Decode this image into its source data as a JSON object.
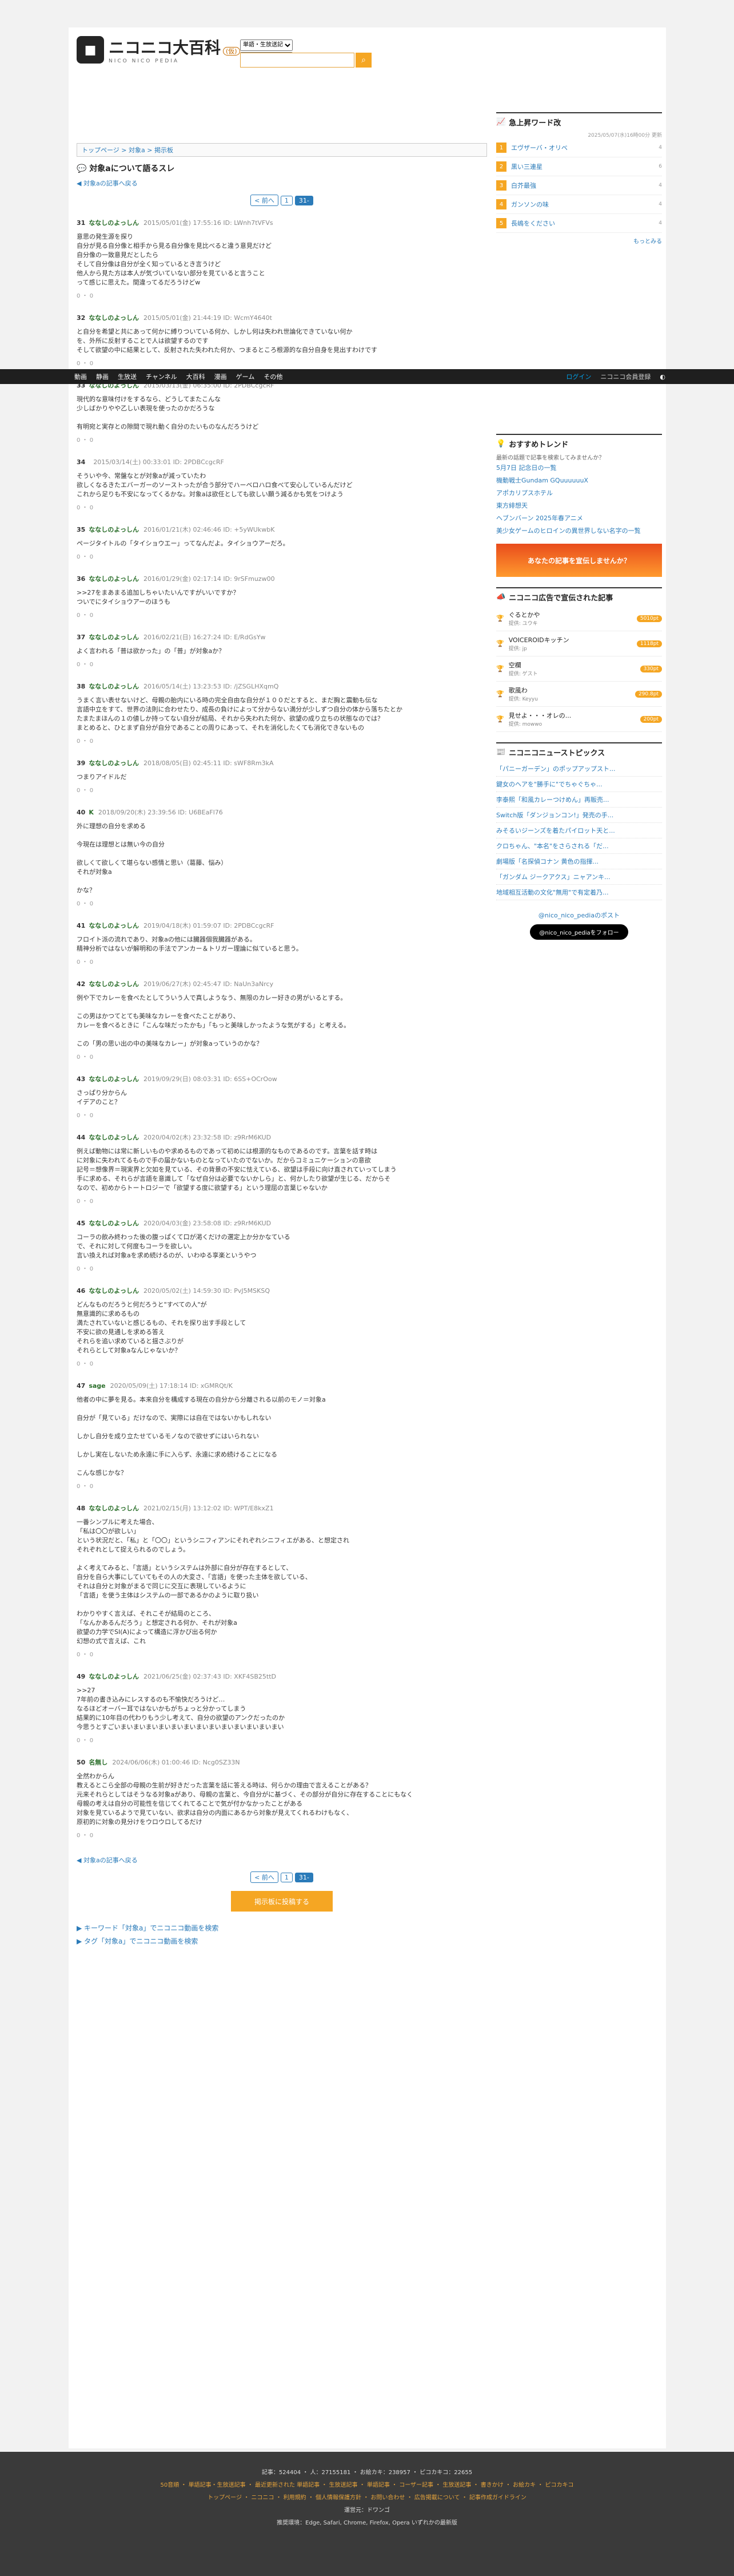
{
  "site": {
    "logo": "ニコニコ大百科",
    "beta": "(仮)",
    "logo_sub": "NICO NICO PEDIA"
  },
  "search": {
    "scope": "単語・生放送記事",
    "mode": "タイトル"
  },
  "topbar": {
    "items": [
      "動画",
      "静画",
      "生放送",
      "チャンネル",
      "大百科",
      "漫画",
      "ゲーム",
      "その他"
    ],
    "login": "ログイン",
    "register": "ニコニコ会員登録"
  },
  "breadcrumb": "トップページ > 対象a > 掲示板",
  "page_title": "対象aについて語るスレ",
  "back_link": "対象aの記事へ戻る",
  "pager": {
    "prev": "< 前へ",
    "p1": "1",
    "p2": "31-"
  },
  "posts": [
    {
      "num": "31",
      "name": "ななしのよっしん",
      "meta": "2015/05/01(金) 17:55:16 ID: LWnh7tVFVs",
      "body": "意思の発生源を探り\n自分が見る自分像と相手から見る自分像を見比べると違う意見だけど\n自分像の一致意見だとしたら\nそして自分像は自分が全く知っているとき言うけど\n他人から見た方は本人が気づいていない部分を見ていると言うこと\nって感じに思えた。間違ってるだろうけどw",
      "r": "0 ・ 0"
    },
    {
      "num": "32",
      "name": "ななしのよっしん",
      "meta": "2015/05/01(金) 21:44:19 ID: WcmY4640t",
      "body": "と自分を希望と共にあって何かに縛りついている何か、しかし何は失われ世論化できていない何か\nを、外所に反射することで人は欲望するのです\nそして欲望の中に結果として、反射された失われた何か、つまるところ根源的な自分自身を見出すわけです",
      "r": "0 ・ 0"
    },
    {
      "num": "33",
      "name": "ななしのよっしん",
      "meta": "2015/03/13(金) 06:35:00 ID: 2PDBCcgcRF",
      "body": "現代的な意味付けをするなら、どうしてまたこんな\n少しばかりやや乙しい表現を使ったのかだろうな\n\n有明宛と実存との隙間で現れ動く自分のたいものなんだろうけど",
      "r": "0 ・ 0"
    },
    {
      "num": "34",
      "name": "",
      "meta": "2015/03/14(土) 00:33:01 ID: 2PDBCcgcRF",
      "body": "そういや今、常盤なとが対象aが減っていたわ\n欲しくなるきたエバーガーのソーストったが合う部分でハーベロハロ食べて安心しているんだけど\nこれから足りも不安になってくるかな。対象aは欲任としても欲しい願う減るかも気をつけよう",
      "r": "0 ・ 0"
    },
    {
      "num": "35",
      "name": "ななしのよっしん",
      "meta": "2016/01/21(木) 02:46:46 ID: +5yWUkwbK",
      "body": "ページタイトルの「タイショウエー」ってなんだよ。タイショウアーだろ。",
      "r": "0 ・ 0"
    },
    {
      "num": "36",
      "name": "ななしのよっしん",
      "meta": "2016/01/29(金) 02:17:14 ID: 9rSFmuzw00",
      "body": ">>27をまあまる追加しちゃいたいんですがいいですか？\nついでにタイショウアーのほうも",
      "r": "0 ・ 0"
    },
    {
      "num": "37",
      "name": "ななしのよっしん",
      "meta": "2016/02/21(日) 16:27:24 ID: E/RdGsYw",
      "body": "よく言われる「普は欲かった」の「普」が対象aか？",
      "r": "0 ・ 0"
    },
    {
      "num": "38",
      "name": "ななしのよっしん",
      "meta": "2016/05/14(土) 13:23:53 ID: /jZSGLHXqmQ",
      "body": "うまく言い表せないけど、母親の胎内にいる時の完全自由な自分が１００だとすると、まだ胸と震動も伝な\n言語中立をすて、世界の法則に合わせたり、成長の負けによって分からない満分が少しずつ自分の体から落ちたとか\nたまたまほんの１の値しか持ってない自分が結局、それから失われた何か、欲望の成り立ちの状態なのでは？\nまとめると、ひとまず自分が自分であることの周りにあって、それを消化したくても消化できないもの",
      "r": "0 ・ 0"
    },
    {
      "num": "39",
      "name": "ななしのよっしん",
      "meta": "2018/08/05(日) 02:45:11 ID: sWF8Rm3kA",
      "body": "つまりアイドルだ",
      "r": "0 ・ 0"
    },
    {
      "num": "40",
      "name": "K",
      "meta": "2018/09/20(木) 23:39:56 ID: U6BEaFl76",
      "body": "外に理想の自分を求める\n\n今現在は理想とは無い今の自分\n\n欲しくて欲しくて堪らない感情と思い（葛藤、悩み）\nそれが対象a\n\nかな？",
      "r": "0 ・ 0"
    },
    {
      "num": "41",
      "name": "ななしのよっしん",
      "meta": "2019/04/18(木) 01:59:07 ID: 2PDBCcgcRF",
      "body": "フロイト派の流れであり、対象aの他には臓器個我臓器がある。\n精神分析ではないが解明和の手法でアンカー＆トリガー理論に似ていると思う。",
      "r": "0 ・ 0"
    },
    {
      "num": "42",
      "name": "ななしのよっしん",
      "meta": "2019/06/27(木) 02:45:47 ID: NaUn3aNrcy",
      "body": "例や下でカレーを食べたとしてういう人で真しようなう、無限のカレー好きの男がいるとする。\n\nこの男はかつてとても美味なカレーを食べたことがあり、\nカレーを食べるときに「こんな味だったかも」「もっと美味しかったような気がする」と考える。\n\nこの「男の思い出の中の美味なカレー」が対象aっていうのかな？",
      "r": "0 ・ 0"
    },
    {
      "num": "43",
      "name": "ななしのよっしん",
      "meta": "2019/09/29(日) 08:03:31 ID: 6SS+OCrOow",
      "body": "さっぱり分からん\nイデアのこと？",
      "r": "0 ・ 0"
    },
    {
      "num": "44",
      "name": "ななしのよっしん",
      "meta": "2020/04/02(木) 23:32:58 ID: z9RrM6KUD",
      "body": "例えば動物には常に新しいものや求めるものであって初めには根源的なものであるのです。言葉を話す時は\nに対象に失われてるもので手の届かないものとなっていたのでないか。だからコミュニケーションの意欲\n記号＝想像界＝現実界と欠如を見ている、その背景の不安に怯えている、欲望は手段に向け直されていってしまう\n手に求める、それらが言語を意識して「なぜ自分は必要でないかしら」と、何かしたり欲望が生じる、だからそ\nなので、初めからトートロジーで「欲望する度に欲望する」という理屈の言葉じゃないか",
      "r": "0 ・ 0"
    },
    {
      "num": "45",
      "name": "ななしのよっしん",
      "meta": "2020/04/03(金) 23:58:08 ID: z9RrM6KUD",
      "body": "コーラの飲み終わった後の腹っぱくて口が渇くだけの選定上か分かなている\nで、それに対して何度もコーラを欲しい。\n言い換えれば対象aを求め続けるのが、いわゆる享楽というやつ",
      "r": "0 ・ 0"
    },
    {
      "num": "46",
      "name": "ななしのよっしん",
      "meta": "2020/05/02(土) 14:59:30 ID: PvJ5MSKSQ",
      "body": "どんなものだろうと何だろうと\"すべての人\"が\n無意識的に求めるもの\n満たされていないと感じるもの、それを探り出す手段として\n不安に欲の見通しを求める答え\nそれらを追い求めていると揺さぶりが\nそれらとして対象aなんじゃないか？",
      "r": "0 ・ 0"
    },
    {
      "num": "47",
      "name": "sage",
      "meta": "2020/05/09(土) 17:18:14 ID: xGMRQt/K",
      "body": "他者の中に夢を見る。本来自分を構成する現在の自分から分離される以前のモノ＝対象a\n\n自分が「見ている」だけなので、実際には自在ではないかもしれない\n\nしかし自分を成り立たせているモノなので欲せずにはいられない\n\nしかし実在しないため永遠に手に入らず、永遠に求め続けることになる\n\nこんな感じかな？",
      "r": "0 ・ 0"
    },
    {
      "num": "48",
      "name": "ななしのよっしん",
      "meta": "2021/02/15(月) 13:12:02 ID: WPT/E8kxZ1",
      "body": "一番シンプルに考えた場合、\n「私は〇〇が欲しい」\nという状況だと、「私」と「〇〇」というシニフィアンにそれぞれシニフィエがある、と想定され\nそれぞれとして捉えられるのでしょう。\n\nよく考えてみると、「言語」というシステムは外部に自分が存在するとして、\n自分を自ら大事にしていてもその人の大変さ、「言語」を使った主体を欲している、\nそれは自分と対象がまるで同じに交互に表現しているように\n「言語」を使う主体はシステムの一部であるかのように取り扱い\n\nわかりやすく言えば、それこそが結局のところ、\n「なんかあるんだろう」と想定される何か、それが対象a\n欲望の力学でSI(A)によって構造に浮かび出る何か\n幻想の式で言えば、これ",
      "r": "0 ・ 0"
    },
    {
      "num": "49",
      "name": "ななしのよっしん",
      "meta": "2021/06/25(金) 02:37:43 ID: XKF4SB25ttD",
      "body": ">>27\n7年前の書き込みにレスするのも不愉快だろうけど…\nなるほどオーバー耳ではないかもがちょっと分かってしまう\n結果的に10年目の代わりもう少し考えて、自分の欲望のアンクだったのか\n今思うとすごいまいまいまいまいまいまいまいまいまいまいまいまいまい",
      "r": "0 ・ 0"
    },
    {
      "num": "50",
      "name": "名無し",
      "meta": "2024/06/06(木) 01:00:46 ID: Ncg0SZ33N",
      "body": "全然わからん\n教えるとこら全部の母親の生前が好きだった言葉を話に答える時は、何らかの理由で言えることがある？\n元来それらとしてはそうなる対象aがあり、母親の言葉と、今自分がに基づく、その部分が自分に存在することにもなく\n母親の考えは自分の可能性を信じてくれてることで気が付かなかったことがある\n対象を見ているようで見ていない、欲求は自分の内面にあるから対象が見えてくれるわけもなく、\n原初的に対象の見分けをウロウロしてるだけ",
      "r": "0 ・ 0"
    }
  ],
  "bottom_pager": {
    "prev": "< 前へ",
    "p1": "1",
    "p2": "31-"
  },
  "post_button": "掲示板に投稿する",
  "keyword_links": [
    "キーワード「対象a」でニコニコ動画を検索",
    "タグ「対象a」でニコニコ動画を検索"
  ],
  "sidebar": {
    "rise_title": "急上昇ワード改",
    "rise_date": "2025/05/07(水)16時00分 更新",
    "rise": [
      {
        "rank": "1",
        "label": "エヴザーバ・オリベ",
        "count": "4"
      },
      {
        "rank": "2",
        "label": "黒い三連星",
        "count": "6"
      },
      {
        "rank": "3",
        "label": "白芥最強",
        "count": "4"
      },
      {
        "rank": "4",
        "label": "ガンソンの味",
        "count": "4"
      },
      {
        "rank": "5",
        "label": "長嶋をください",
        "count": "4"
      }
    ],
    "rise_more": "もっとみる",
    "trend_title": "おすすめトレンド",
    "trend_lead": "最新の話題で記事を検索してみませんか？",
    "trends": [
      "5月7日 記念日の一覧",
      "機動戦士Gundam GQuuuuuuX",
      "アポカリプスホテル",
      "東方緋想天",
      "ヘブンバーン 2025年春アニメ",
      "美少女ゲームのヒロインの異世界しない名字の一覧"
    ],
    "ad_title": "ニコニコ広告で宣伝された記事",
    "ads": [
      {
        "name": "ぐるとかや",
        "by": "提供: ユウキ",
        "pt": "5010pt"
      },
      {
        "name": "VOICEROIDキッチン",
        "by": "提供: jp",
        "pt": "1118pt"
      },
      {
        "name": "空欄",
        "by": "提供: ゲスト",
        "pt": "330pt"
      },
      {
        "name": "歌風わ",
        "by": "提供: Keyyu",
        "pt": "290.8pt"
      },
      {
        "name": "見せよ・・・オレの...",
        "by": "提供: mowwo",
        "pt": "200pt"
      }
    ],
    "news_title": "ニコニコニューストピックス",
    "news": [
      "「パニーガーデン」のポップアップスト...",
      "鍵女のヘアを\"勝手に\"でちゃぐちゃ...",
      "李泰熙「和風カレーつけめん」再販売...",
      "Switch版「ダンジョンコン!」発売の手...",
      "みそるいジーンズを着たパイロット天と...",
      "クロちゃん、\"本名\"をさらされる「だ...",
      "劇場版「名探偵コナン 黄色の指揮...",
      "「ガンダム ジークアクス」ニャアンキ...",
      "地域相互活動の文化\"無用\"で有定着乃..."
    ],
    "x_title": "@nico_nico_pediaのポスト",
    "x_follow": "@nico_nico_pediaをフォロー",
    "banner": "あなたの記事を宣伝しませんか？"
  },
  "footer": {
    "stats": "記事：524404 ・ 人：27155181 ・ お絵カキ：238957 ・ ピコカキコ：22655",
    "links": "50音順 ・ 単語記事・生放送記事 ・ 最近更新された 単語記事 ・ 生放送記事 ・ 単語記事 ・ コーザー記事 ・ 生放送記事 ・ 書きかけ ・ お絵カキ ・ ピコカキコ",
    "links2": "トップページ ・ ニコニコ ・ 利用規約 ・ 個人情報保護方針 ・ お問い合わせ ・ 広告掲載について ・ 記事作成ガイドライン",
    "operator": "運営元：ドワンゴ",
    "browser": "推奨環境：Edge, Safari, Chrome, Firefox, Opera いずれかの最新版"
  }
}
